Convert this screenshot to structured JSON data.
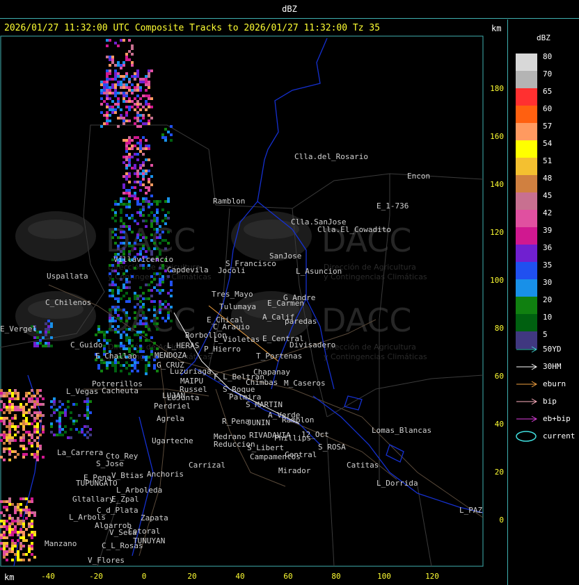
{
  "header": {
    "top_label": "dBZ",
    "title": "2026/01/27 11:32:00 UTC Composite Tracks to 2026/01/27 11:32:00 Tz 35",
    "unit": "km"
  },
  "axes": {
    "x_ticks": [
      "-40",
      "-20",
      "0",
      "20",
      "40",
      "60",
      "80",
      "100",
      "120"
    ],
    "y_ticks": [
      "180",
      "160",
      "140",
      "120",
      "100",
      "80",
      "60",
      "40",
      "20",
      "0"
    ]
  },
  "places": [
    "Clla.del_Rosario",
    "Encon",
    "Ramblon",
    "E_1-736",
    "Clla.SanJose",
    "Clla.El_Cowadito",
    "Villavicencio",
    "Capdevila",
    "S_Francisco",
    "SanJose",
    "Uspallata",
    "Jocoli",
    "L_Asuncion",
    "Tres_Mayo",
    "C_Chilenos",
    "Tulumaya",
    "E_Carmen",
    "G_Andre",
    "E_Chical",
    "C_Arauio",
    "A_Calif",
    "paredas",
    "E_Vergel",
    "Borbollon",
    "L_Violetas",
    "E_Central",
    "Divisadero",
    "C_Guido",
    "L_HERAS",
    "P_Hierro",
    "E_Challao",
    "MENDOZA",
    "T_Portenas",
    "G_CRUZ",
    "Luzuriaga",
    "Chapanay",
    "Potrerillos",
    "MAIPU",
    "F_L_Beltran",
    "L_Vegas",
    "Cacheuta",
    "Russel",
    "Chimbas",
    "M_Caseros",
    "LUJAN",
    "S_Roque",
    "Palmira",
    "LUJunta",
    "Perdriel",
    "S_MARTIN",
    "A_Verde",
    "Agrela",
    "R_Pena",
    "JUNIN",
    "Ramblon",
    "Ugarteche",
    "Medrano",
    "RIVADAVIA",
    "Phillips",
    "12_Oct",
    "Lomas_Blancas",
    "La_Carrera",
    "Cto_Rey",
    "Reduccion",
    "S_Libert",
    "S_ROSA",
    "S_Jose",
    "Carrizal",
    "Campamentos",
    "Central",
    "Catitas",
    "E_Pena",
    "V_Btias",
    "Anchoris",
    "Mirador",
    "L_Dorrida",
    "TUPUNGATO",
    "L_Arboleda",
    "Gltallary",
    "E_Zpal",
    "C_d_Plata",
    "L_PAZ",
    "L_Arbols",
    "Zapata",
    "Algarrob",
    "V_Seca",
    "Cotoral",
    "TUNUYAN",
    "Manzano",
    "C_L_Rosas",
    "V_Flores"
  ],
  "watermark": {
    "brand": "DACC",
    "line1": "Dirección de Agricultura",
    "line2": "y Contingencias Climáticas"
  },
  "legend": {
    "title": "dBZ",
    "levels": [
      {
        "label": "80",
        "color": "#d8d8d8"
      },
      {
        "label": "70",
        "color": "#b4b4b4"
      },
      {
        "label": "65",
        "color": "#ff3030"
      },
      {
        "label": "60",
        "color": "#ff6010"
      },
      {
        "label": "57",
        "color": "#ff9a60"
      },
      {
        "label": "54",
        "color": "#ffff00"
      },
      {
        "label": "51",
        "color": "#f4c030"
      },
      {
        "label": "48",
        "color": "#d08040"
      },
      {
        "label": "45",
        "color": "#c87090"
      },
      {
        "label": "42",
        "color": "#e050a0"
      },
      {
        "label": "39",
        "color": "#d01890"
      },
      {
        "label": "36",
        "color": "#7020d0"
      },
      {
        "label": "35",
        "color": "#2050f0"
      },
      {
        "label": "30",
        "color": "#1890e8"
      },
      {
        "label": "20",
        "color": "#108010"
      },
      {
        "label": "10",
        "color": "#006010"
      },
      {
        "label": "5",
        "color": "#403880"
      }
    ],
    "tracks": [
      {
        "label": "50YD",
        "color": "#40d0d0"
      },
      {
        "label": "30HM",
        "color": "#ffffff"
      },
      {
        "label": "eburn",
        "color": "#f0a040"
      },
      {
        "label": "bip",
        "color": "#ffb0c0"
      },
      {
        "label": "eb+bip",
        "color": "#e040e0"
      },
      {
        "label": "current",
        "color": "#40e0e0"
      }
    ]
  }
}
